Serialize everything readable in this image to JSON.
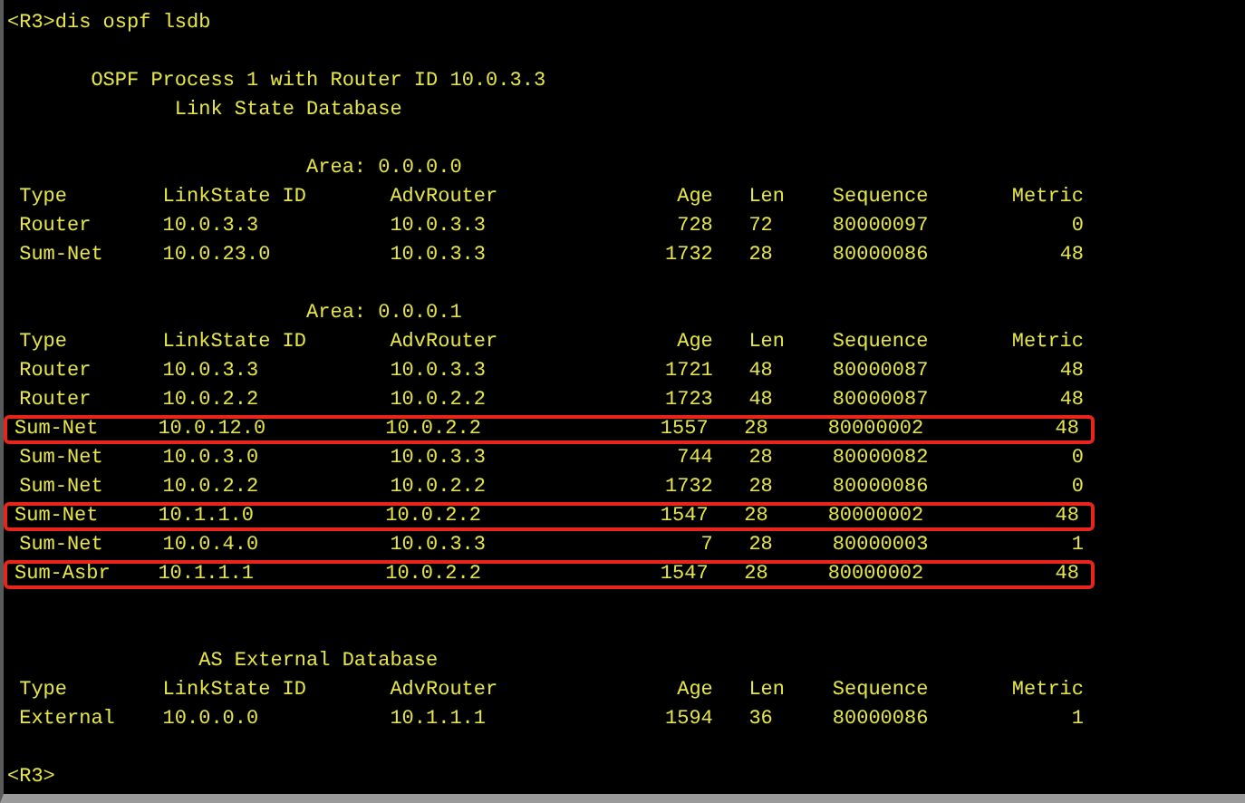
{
  "prompt_command": "<R3>dis ospf lsdb",
  "process_title": "OSPF Process 1 with Router ID 10.0.3.3",
  "database_title": "Link State Database",
  "sections": [
    {
      "kind": "area",
      "title": "Area: 0.0.0.0",
      "columns": [
        "Type",
        "LinkState ID",
        "AdvRouter",
        "Age",
        "Len",
        "Sequence",
        "Metric"
      ],
      "rows": [
        {
          "cells": [
            "Router",
            "10.0.3.3",
            "10.0.3.3",
            "728",
            "72",
            "80000097",
            "0"
          ],
          "highlighted": false
        },
        {
          "cells": [
            "Sum-Net",
            "10.0.23.0",
            "10.0.3.3",
            "1732",
            "28",
            "80000086",
            "48"
          ],
          "highlighted": false
        }
      ]
    },
    {
      "kind": "area",
      "title": "Area: 0.0.0.1",
      "columns": [
        "Type",
        "LinkState ID",
        "AdvRouter",
        "Age",
        "Len",
        "Sequence",
        "Metric"
      ],
      "rows": [
        {
          "cells": [
            "Router",
            "10.0.3.3",
            "10.0.3.3",
            "1721",
            "48",
            "80000087",
            "48"
          ],
          "highlighted": false
        },
        {
          "cells": [
            "Router",
            "10.0.2.2",
            "10.0.2.2",
            "1723",
            "48",
            "80000087",
            "48"
          ],
          "highlighted": false
        },
        {
          "cells": [
            "Sum-Net",
            "10.0.12.0",
            "10.0.2.2",
            "1557",
            "28",
            "80000002",
            "48"
          ],
          "highlighted": true
        },
        {
          "cells": [
            "Sum-Net",
            "10.0.3.0",
            "10.0.3.3",
            "744",
            "28",
            "80000082",
            "0"
          ],
          "highlighted": false
        },
        {
          "cells": [
            "Sum-Net",
            "10.0.2.2",
            "10.0.2.2",
            "1732",
            "28",
            "80000086",
            "0"
          ],
          "highlighted": false
        },
        {
          "cells": [
            "Sum-Net",
            "10.1.1.0",
            "10.0.2.2",
            "1547",
            "28",
            "80000002",
            "48"
          ],
          "highlighted": true
        },
        {
          "cells": [
            "Sum-Net",
            "10.0.4.0",
            "10.0.3.3",
            "7",
            "28",
            "80000003",
            "1"
          ],
          "highlighted": false
        },
        {
          "cells": [
            "Sum-Asbr",
            "10.1.1.1",
            "10.0.2.2",
            "1547",
            "28",
            "80000002",
            "48"
          ],
          "highlighted": true
        }
      ]
    },
    {
      "kind": "external",
      "title": "AS External Database",
      "columns": [
        "Type",
        "LinkState ID",
        "AdvRouter",
        "Age",
        "Len",
        "Sequence",
        "Metric"
      ],
      "rows": [
        {
          "cells": [
            "External",
            "10.0.0.0",
            "10.1.1.1",
            "1594",
            "36",
            "80000086",
            "1"
          ],
          "highlighted": false
        }
      ]
    }
  ],
  "final_prompt": "<R3>"
}
